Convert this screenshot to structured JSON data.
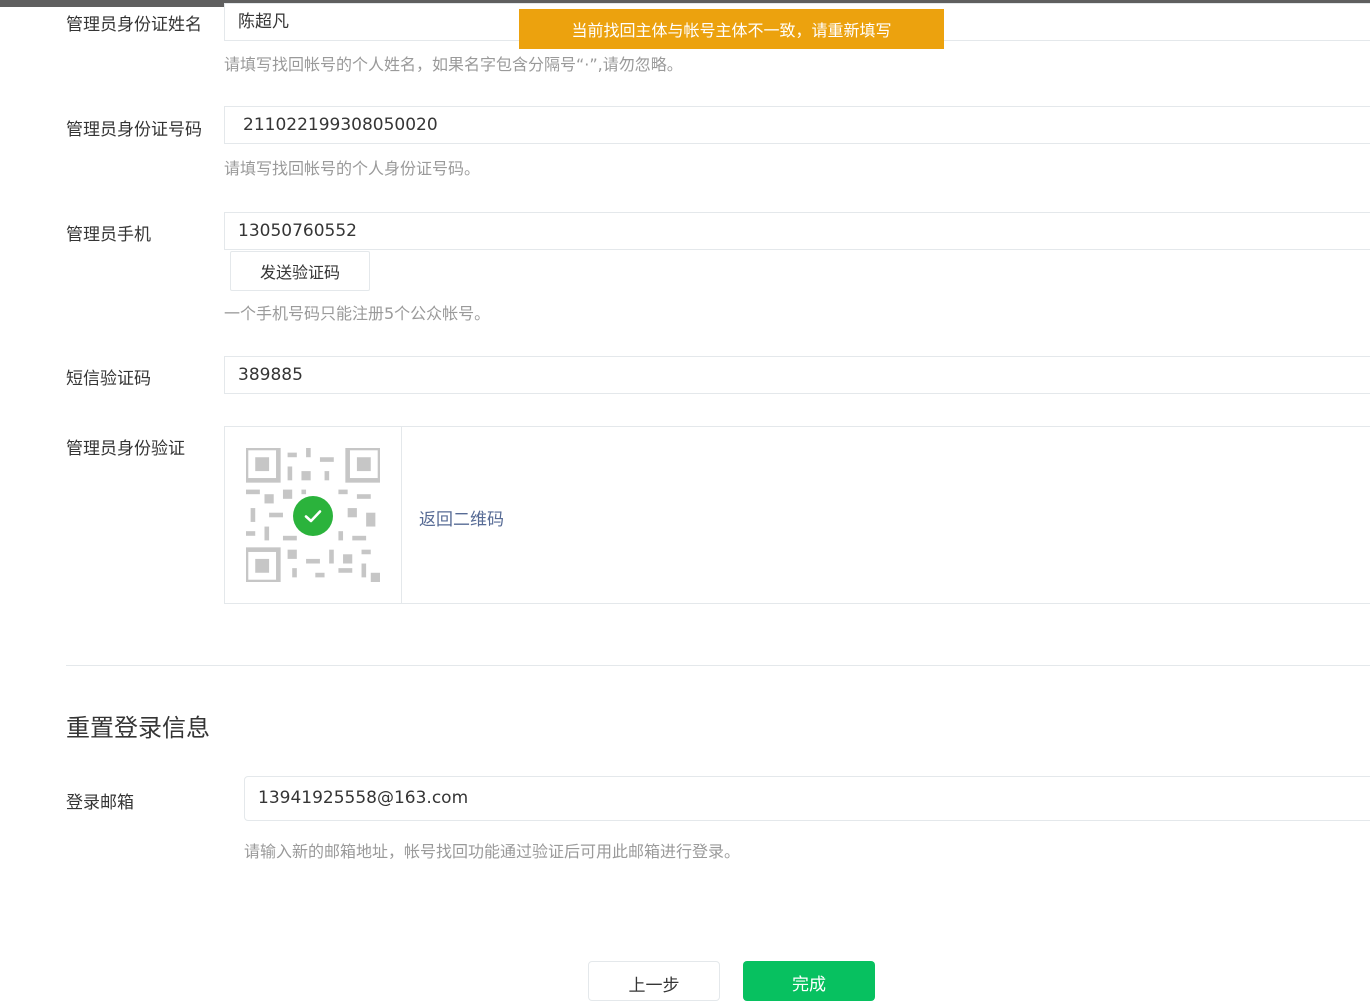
{
  "toast": {
    "message": "当前找回主体与帐号主体不一致，请重新填写"
  },
  "admin": {
    "name": {
      "label": "管理员身份证姓名",
      "value": "陈超凡",
      "hint": "请填写找回帐号的个人姓名，如果名字包含分隔号“·”,请勿忽略。"
    },
    "id_number": {
      "label": "管理员身份证号码",
      "value": "211022199308050020",
      "hint": "请填写找回帐号的个人身份证号码。"
    },
    "phone": {
      "label": "管理员手机",
      "value": "13050760552",
      "send_code_label": "发送验证码",
      "hint": "一个手机号码只能注册5个公众帐号。"
    },
    "sms_code": {
      "label": "短信验证码",
      "value": "389885"
    },
    "identity_verify": {
      "label": "管理员身份验证",
      "back_link": "返回二维码"
    }
  },
  "reset_login": {
    "title": "重置登录信息",
    "email": {
      "label": "登录邮箱",
      "value": "13941925558@163.com",
      "hint": "请输入新的邮箱地址，帐号找回功能通过验证后可用此邮箱进行登录。"
    }
  },
  "footer": {
    "prev_label": "上一步",
    "done_label": "完成"
  },
  "colors": {
    "toast": "#eca20e",
    "success": "#2bb33c",
    "link": "#576b95",
    "primary": "#07c160"
  },
  "icons": {
    "verified": "check-circle-icon",
    "qr": "qr-code-icon"
  }
}
